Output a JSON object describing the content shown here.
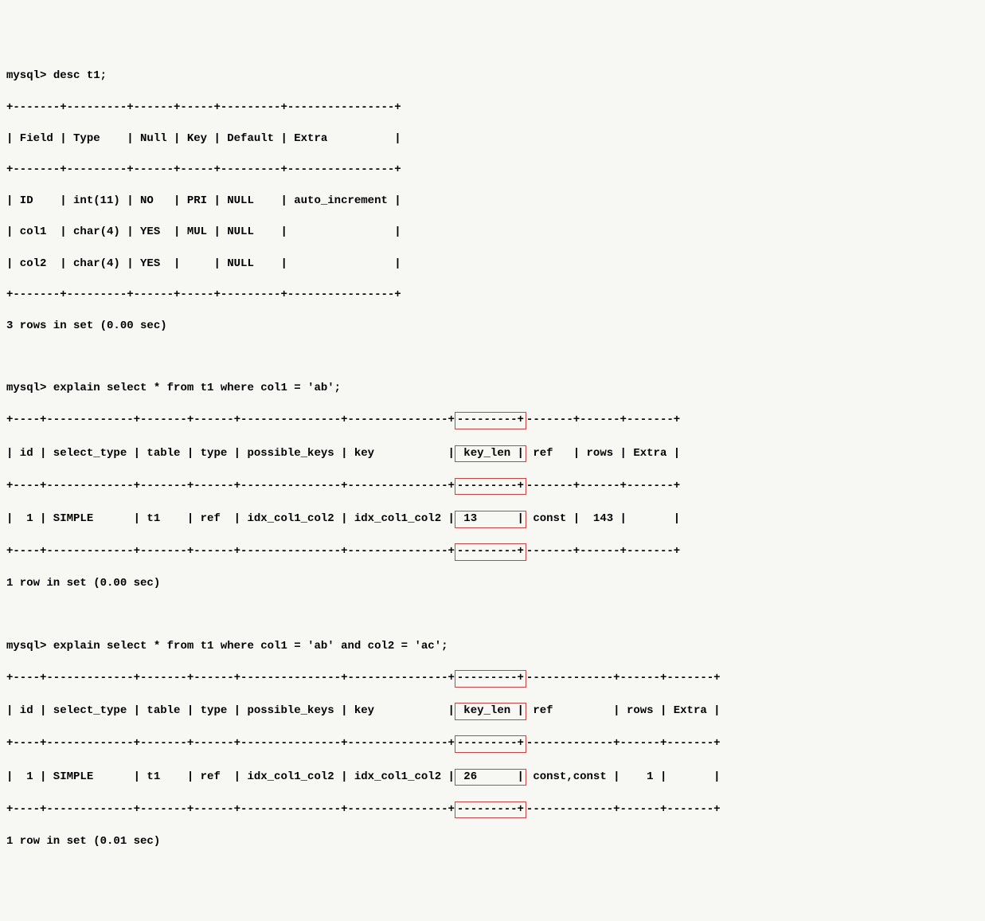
{
  "prompt": "mysql> ",
  "commands": {
    "desc": "desc t1;",
    "explain1": "explain select * from t1 where col1 = 'ab';",
    "explain2": "explain select * from t1 where col1 = 'ab' and col2 = 'ac';"
  },
  "desc_table": {
    "border_top": "+-------+---------+------+-----+---------+----------------+",
    "header": "| Field | Type    | Null | Key | Default | Extra          |",
    "rows": [
      "| ID    | int(11) | NO   | PRI | NULL    | auto_increment |",
      "| col1  | char(4) | YES  | MUL | NULL    |                |",
      "| col2  | char(4) | YES  |     | NULL    |                |"
    ],
    "footer": "3 rows in set (0.00 sec)"
  },
  "explain1_table": {
    "left_seg_border": "+----+-------------+-------+------+---------------+---------------+",
    "hl_seg_border": "---------+",
    "right_seg_border": "-------+------+-------+",
    "left_header": "| id | select_type | table | type | possible_keys | key           |",
    "hl_header": " key_len |",
    "right_header": " ref   | rows | Extra |",
    "left_row": "|  1 | SIMPLE      | t1    | ref  | idx_col1_col2 | idx_col1_col2 |",
    "hl_row": " 13      |",
    "right_row": " const |  143 |       |",
    "footer": "1 row in set (0.00 sec)"
  },
  "explain2_table": {
    "left_seg_border": "+----+-------------+-------+------+---------------+---------------+",
    "hl_seg_border": "---------+",
    "right_seg_border": "-------------+------+-------+",
    "left_header": "| id | select_type | table | type | possible_keys | key           |",
    "hl_header": " key_len |",
    "right_header": " ref         | rows | Extra |",
    "left_row": "|  1 | SIMPLE      | t1    | ref  | idx_col1_col2 | idx_col1_col2 |",
    "hl_row": " 26      |",
    "right_row": " const,const |    1 |       |",
    "footer": "1 row in set (0.01 sec)"
  },
  "chart_data": {
    "type": "table",
    "tables": [
      {
        "name": "desc t1",
        "columns": [
          "Field",
          "Type",
          "Null",
          "Key",
          "Default",
          "Extra"
        ],
        "rows": [
          [
            "ID",
            "int(11)",
            "NO",
            "PRI",
            "NULL",
            "auto_increment"
          ],
          [
            "col1",
            "char(4)",
            "YES",
            "MUL",
            "NULL",
            ""
          ],
          [
            "col2",
            "char(4)",
            "YES",
            "",
            "NULL",
            ""
          ]
        ]
      },
      {
        "name": "explain col1='ab'",
        "columns": [
          "id",
          "select_type",
          "table",
          "type",
          "possible_keys",
          "key",
          "key_len",
          "ref",
          "rows",
          "Extra"
        ],
        "rows": [
          [
            "1",
            "SIMPLE",
            "t1",
            "ref",
            "idx_col1_col2",
            "idx_col1_col2",
            "13",
            "const",
            "143",
            ""
          ]
        ]
      },
      {
        "name": "explain col1='ab' and col2='ac'",
        "columns": [
          "id",
          "select_type",
          "table",
          "type",
          "possible_keys",
          "key",
          "key_len",
          "ref",
          "rows",
          "Extra"
        ],
        "rows": [
          [
            "1",
            "SIMPLE",
            "t1",
            "ref",
            "idx_col1_col2",
            "idx_col1_col2",
            "26",
            "const,const",
            "1",
            ""
          ]
        ]
      }
    ]
  }
}
